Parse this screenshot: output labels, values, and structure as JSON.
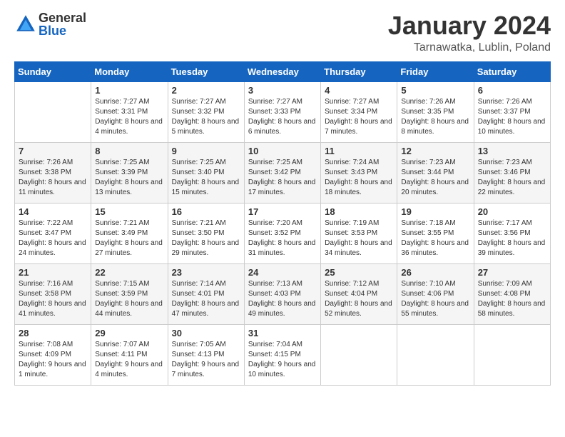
{
  "logo": {
    "general": "General",
    "blue": "Blue"
  },
  "title": "January 2024",
  "location": "Tarnawatka, Lublin, Poland",
  "weekdays": [
    "Sunday",
    "Monday",
    "Tuesday",
    "Wednesday",
    "Thursday",
    "Friday",
    "Saturday"
  ],
  "weeks": [
    [
      {
        "day": "",
        "sunrise": "",
        "sunset": "",
        "daylight": ""
      },
      {
        "day": "1",
        "sunrise": "Sunrise: 7:27 AM",
        "sunset": "Sunset: 3:31 PM",
        "daylight": "Daylight: 8 hours and 4 minutes."
      },
      {
        "day": "2",
        "sunrise": "Sunrise: 7:27 AM",
        "sunset": "Sunset: 3:32 PM",
        "daylight": "Daylight: 8 hours and 5 minutes."
      },
      {
        "day": "3",
        "sunrise": "Sunrise: 7:27 AM",
        "sunset": "Sunset: 3:33 PM",
        "daylight": "Daylight: 8 hours and 6 minutes."
      },
      {
        "day": "4",
        "sunrise": "Sunrise: 7:27 AM",
        "sunset": "Sunset: 3:34 PM",
        "daylight": "Daylight: 8 hours and 7 minutes."
      },
      {
        "day": "5",
        "sunrise": "Sunrise: 7:26 AM",
        "sunset": "Sunset: 3:35 PM",
        "daylight": "Daylight: 8 hours and 8 minutes."
      },
      {
        "day": "6",
        "sunrise": "Sunrise: 7:26 AM",
        "sunset": "Sunset: 3:37 PM",
        "daylight": "Daylight: 8 hours and 10 minutes."
      }
    ],
    [
      {
        "day": "7",
        "sunrise": "Sunrise: 7:26 AM",
        "sunset": "Sunset: 3:38 PM",
        "daylight": "Daylight: 8 hours and 11 minutes."
      },
      {
        "day": "8",
        "sunrise": "Sunrise: 7:25 AM",
        "sunset": "Sunset: 3:39 PM",
        "daylight": "Daylight: 8 hours and 13 minutes."
      },
      {
        "day": "9",
        "sunrise": "Sunrise: 7:25 AM",
        "sunset": "Sunset: 3:40 PM",
        "daylight": "Daylight: 8 hours and 15 minutes."
      },
      {
        "day": "10",
        "sunrise": "Sunrise: 7:25 AM",
        "sunset": "Sunset: 3:42 PM",
        "daylight": "Daylight: 8 hours and 17 minutes."
      },
      {
        "day": "11",
        "sunrise": "Sunrise: 7:24 AM",
        "sunset": "Sunset: 3:43 PM",
        "daylight": "Daylight: 8 hours and 18 minutes."
      },
      {
        "day": "12",
        "sunrise": "Sunrise: 7:23 AM",
        "sunset": "Sunset: 3:44 PM",
        "daylight": "Daylight: 8 hours and 20 minutes."
      },
      {
        "day": "13",
        "sunrise": "Sunrise: 7:23 AM",
        "sunset": "Sunset: 3:46 PM",
        "daylight": "Daylight: 8 hours and 22 minutes."
      }
    ],
    [
      {
        "day": "14",
        "sunrise": "Sunrise: 7:22 AM",
        "sunset": "Sunset: 3:47 PM",
        "daylight": "Daylight: 8 hours and 24 minutes."
      },
      {
        "day": "15",
        "sunrise": "Sunrise: 7:21 AM",
        "sunset": "Sunset: 3:49 PM",
        "daylight": "Daylight: 8 hours and 27 minutes."
      },
      {
        "day": "16",
        "sunrise": "Sunrise: 7:21 AM",
        "sunset": "Sunset: 3:50 PM",
        "daylight": "Daylight: 8 hours and 29 minutes."
      },
      {
        "day": "17",
        "sunrise": "Sunrise: 7:20 AM",
        "sunset": "Sunset: 3:52 PM",
        "daylight": "Daylight: 8 hours and 31 minutes."
      },
      {
        "day": "18",
        "sunrise": "Sunrise: 7:19 AM",
        "sunset": "Sunset: 3:53 PM",
        "daylight": "Daylight: 8 hours and 34 minutes."
      },
      {
        "day": "19",
        "sunrise": "Sunrise: 7:18 AM",
        "sunset": "Sunset: 3:55 PM",
        "daylight": "Daylight: 8 hours and 36 minutes."
      },
      {
        "day": "20",
        "sunrise": "Sunrise: 7:17 AM",
        "sunset": "Sunset: 3:56 PM",
        "daylight": "Daylight: 8 hours and 39 minutes."
      }
    ],
    [
      {
        "day": "21",
        "sunrise": "Sunrise: 7:16 AM",
        "sunset": "Sunset: 3:58 PM",
        "daylight": "Daylight: 8 hours and 41 minutes."
      },
      {
        "day": "22",
        "sunrise": "Sunrise: 7:15 AM",
        "sunset": "Sunset: 3:59 PM",
        "daylight": "Daylight: 8 hours and 44 minutes."
      },
      {
        "day": "23",
        "sunrise": "Sunrise: 7:14 AM",
        "sunset": "Sunset: 4:01 PM",
        "daylight": "Daylight: 8 hours and 47 minutes."
      },
      {
        "day": "24",
        "sunrise": "Sunrise: 7:13 AM",
        "sunset": "Sunset: 4:03 PM",
        "daylight": "Daylight: 8 hours and 49 minutes."
      },
      {
        "day": "25",
        "sunrise": "Sunrise: 7:12 AM",
        "sunset": "Sunset: 4:04 PM",
        "daylight": "Daylight: 8 hours and 52 minutes."
      },
      {
        "day": "26",
        "sunrise": "Sunrise: 7:10 AM",
        "sunset": "Sunset: 4:06 PM",
        "daylight": "Daylight: 8 hours and 55 minutes."
      },
      {
        "day": "27",
        "sunrise": "Sunrise: 7:09 AM",
        "sunset": "Sunset: 4:08 PM",
        "daylight": "Daylight: 8 hours and 58 minutes."
      }
    ],
    [
      {
        "day": "28",
        "sunrise": "Sunrise: 7:08 AM",
        "sunset": "Sunset: 4:09 PM",
        "daylight": "Daylight: 9 hours and 1 minute."
      },
      {
        "day": "29",
        "sunrise": "Sunrise: 7:07 AM",
        "sunset": "Sunset: 4:11 PM",
        "daylight": "Daylight: 9 hours and 4 minutes."
      },
      {
        "day": "30",
        "sunrise": "Sunrise: 7:05 AM",
        "sunset": "Sunset: 4:13 PM",
        "daylight": "Daylight: 9 hours and 7 minutes."
      },
      {
        "day": "31",
        "sunrise": "Sunrise: 7:04 AM",
        "sunset": "Sunset: 4:15 PM",
        "daylight": "Daylight: 9 hours and 10 minutes."
      },
      {
        "day": "",
        "sunrise": "",
        "sunset": "",
        "daylight": ""
      },
      {
        "day": "",
        "sunrise": "",
        "sunset": "",
        "daylight": ""
      },
      {
        "day": "",
        "sunrise": "",
        "sunset": "",
        "daylight": ""
      }
    ]
  ]
}
